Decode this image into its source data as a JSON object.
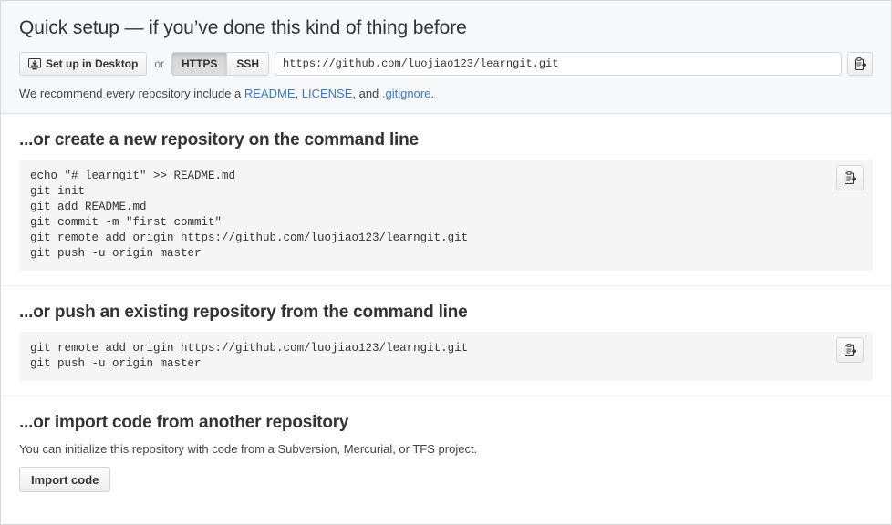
{
  "quick_setup": {
    "title": "Quick setup — if you’ve done this kind of thing before",
    "desktop_button_label": "Set up in Desktop",
    "or_label": "or",
    "protocols": [
      {
        "label": "HTTPS",
        "selected": true
      },
      {
        "label": "SSH",
        "selected": false
      }
    ],
    "clone_url": "https://github.com/luojiao123/learngit.git",
    "copy_icon": "clipboard-copy-icon",
    "desktop_icon": "desktop-download-icon",
    "recommend_prefix": "We recommend every repository include a ",
    "recommend_links": [
      {
        "label": "README",
        "sep": ", "
      },
      {
        "label": "LICENSE",
        "sep": ", and "
      },
      {
        "label": ".gitignore",
        "sep": "."
      }
    ]
  },
  "create_repo_section": {
    "title": "...or create a new repository on the command line",
    "commands": [
      "echo \"# learngit\" >> README.md",
      "git init",
      "git add README.md",
      "git commit -m \"first commit\"",
      "git remote add origin https://github.com/luojiao123/learngit.git",
      "git push -u origin master"
    ],
    "copy_icon": "clipboard-copy-icon"
  },
  "push_existing_section": {
    "title": "...or push an existing repository from the command line",
    "commands": [
      "git remote add origin https://github.com/luojiao123/learngit.git",
      "git push -u origin master"
    ],
    "copy_icon": "clipboard-copy-icon"
  },
  "import_section": {
    "title": "...or import code from another repository",
    "description": "You can initialize this repository with code from a Subversion, Mercurial, or TFS project.",
    "button_label": "Import code"
  },
  "colors": {
    "banner_background": "#f5f9fc",
    "link": "#4078c0",
    "code_background": "#f5f5f5",
    "text": "#333333",
    "border": "#d5d5d5"
  }
}
